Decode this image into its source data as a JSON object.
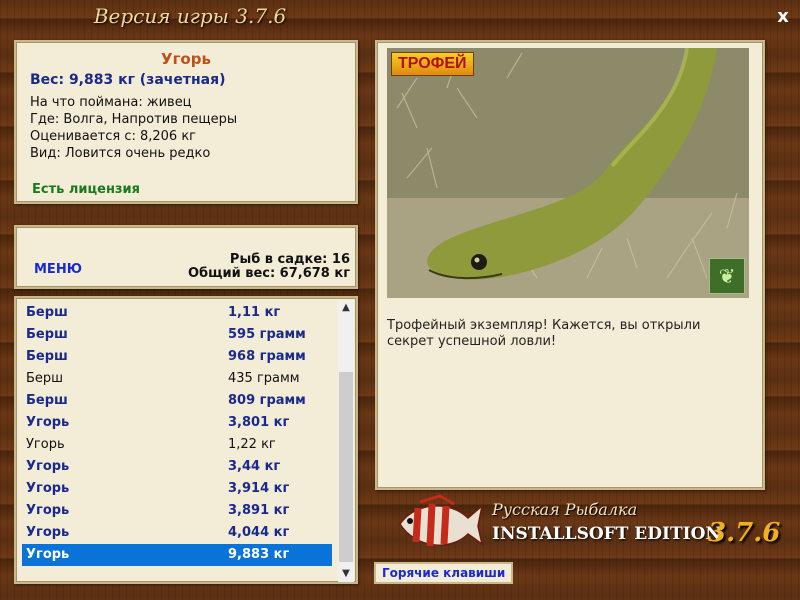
{
  "window": {
    "title": "Версия игры 3.7.6",
    "close_label": "x"
  },
  "fish_info": {
    "name": "Угорь",
    "weight": "Вес: 9,883 кг (зачетная)",
    "bait": "На что поймана: живец",
    "location": "Где: Волга, Напротив пещеры",
    "valued_from": "Оценивается с: 8,206 кг",
    "rarity": "Вид: Ловится очень редко",
    "license": "Есть лицензия"
  },
  "menu_panel": {
    "menu_label": "МЕНЮ",
    "fish_count": "Рыб в садке: 16",
    "total_weight": "Общий вес: 67,678 кг"
  },
  "catch_list": [
    {
      "name": "Берш",
      "weight": "1,11 кг",
      "bold": true
    },
    {
      "name": "Берш",
      "weight": "595 грамм",
      "bold": true
    },
    {
      "name": "Берш",
      "weight": "968 грамм",
      "bold": true
    },
    {
      "name": "Берш",
      "weight": "435 грамм",
      "bold": false
    },
    {
      "name": "Берш",
      "weight": "809 грамм",
      "bold": true
    },
    {
      "name": "Угорь",
      "weight": "3,801 кг",
      "bold": true
    },
    {
      "name": "Угорь",
      "weight": "1,22 кг",
      "bold": false
    },
    {
      "name": "Угорь",
      "weight": "3,44 кг",
      "bold": true
    },
    {
      "name": "Угорь",
      "weight": "3,914 кг",
      "bold": true
    },
    {
      "name": "Угорь",
      "weight": "3,891 кг",
      "bold": true
    },
    {
      "name": "Угорь",
      "weight": "4,044 кг",
      "bold": true
    },
    {
      "name": "Угорь",
      "weight": "9,883 кг",
      "bold": true,
      "selected": true
    }
  ],
  "trophy": {
    "badge": "ТРОФЕЙ",
    "description": "Трофейный экземпляр! Кажется, вы открыли секрет успешной ловли!"
  },
  "logo": {
    "line1": "Русская Рыбалка",
    "line2": "INSTALLSOFT EDITION",
    "version": "3.7.6"
  },
  "hotkeys_label": "Горячие клавиши",
  "colors": {
    "accent_blue": "#1a2a8c",
    "link_blue": "#1a2ad0",
    "selection": "#0a73d8",
    "license_green": "#1a7a1a"
  },
  "icons": [
    "close-icon",
    "butterfly-icon",
    "scroll-up-icon",
    "scroll-down-icon",
    "fish-logo-icon"
  ]
}
